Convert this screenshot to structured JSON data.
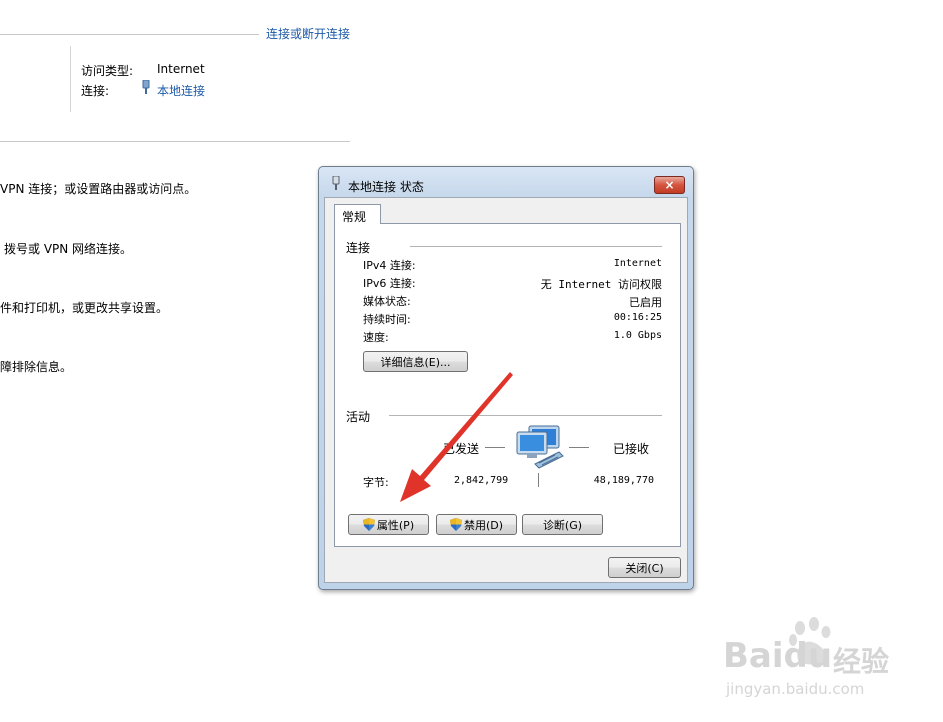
{
  "background": {
    "top_link": "连接或断开连接",
    "access_type_label": "访问类型:",
    "access_type_value": "Internet",
    "connection_label": "连接:",
    "connection_value": "本地连接",
    "task_lines": [
      "VPN 连接；或设置路由器或访问点。",
      "拨号或 VPN 网络连接。",
      "件和打印机，或更改共享设置。",
      "障排除信息。"
    ]
  },
  "dialog": {
    "title": "本地连接 状态",
    "close_symbol": "×",
    "tab_general": "常规",
    "connection_group": "连接",
    "rows": [
      {
        "label": "IPv4 连接:",
        "value": "Internet"
      },
      {
        "label": "IPv6 连接:",
        "value": "无 Internet 访问权限"
      },
      {
        "label": "媒体状态:",
        "value": "已启用"
      },
      {
        "label": "持续时间:",
        "value": "00:16:25"
      },
      {
        "label": "速度:",
        "value": "1.0 Gbps"
      }
    ],
    "details_button": "详细信息(E)...",
    "activity_group": "活动",
    "sent_label": "已发送",
    "received_label": "已接收",
    "bytes_label": "字节:",
    "bytes_sent": "2,842,799",
    "bytes_received": "48,189,770",
    "properties_button": "属性(P)",
    "disable_button": "禁用(D)",
    "diagnose_button": "诊断(G)",
    "close_button": "关闭(C)"
  },
  "watermark": {
    "brand": "Baidu",
    "brand_cn": "经验",
    "url": "jingyan.baidu.com"
  },
  "colors": {
    "link": "#1e5aa8",
    "arrow": "#e0342b",
    "close_button": "#d4543f"
  }
}
